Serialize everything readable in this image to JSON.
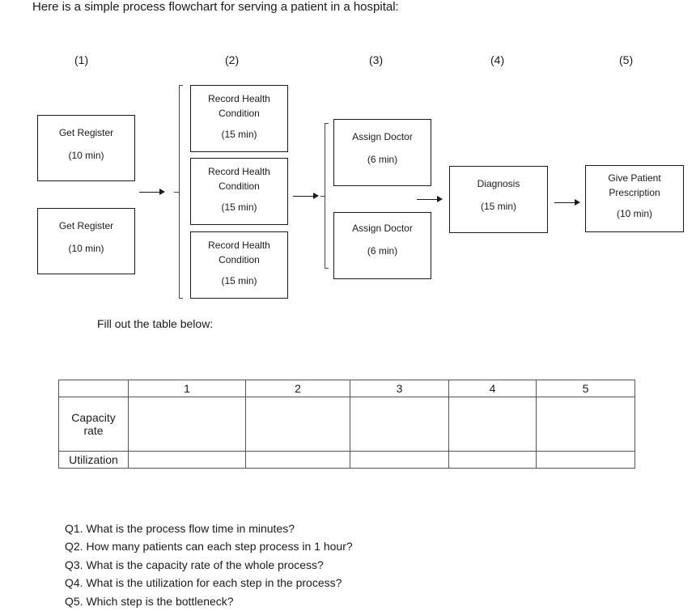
{
  "intro": "Here is a simple process flowchart for serving a patient in a hospital:",
  "step_numbers": [
    "(1)",
    "(2)",
    "(3)",
    "(4)",
    "(5)"
  ],
  "steps": [
    {
      "name": "Get Register",
      "time": "(10 min)",
      "count": 2
    },
    {
      "name": "Record Health Condition",
      "time": "(15 min)",
      "count": 3
    },
    {
      "name": "Assign Doctor",
      "time": "(6 min)",
      "count": 2
    },
    {
      "name": "Diagnosis",
      "time": "(15 min)",
      "count": 1
    },
    {
      "name": "Give Patient Prescription",
      "time": "(10 min)",
      "count": 1
    }
  ],
  "labels": {
    "get_register": "Get Register",
    "time_10": "(10 min)",
    "record_1": "Record Health",
    "record_2": "Condition",
    "time_15": "(15 min)",
    "assign": "Assign Doctor",
    "time_6": "(6 min)",
    "diagnosis": "Diagnosis",
    "give_1": "Give Patient",
    "give_2": "Prescription"
  },
  "fill_instruction": "Fill out the table below:",
  "table": {
    "columns": [
      "",
      "1",
      "2",
      "3",
      "4",
      "5"
    ],
    "rows": [
      {
        "label_line1": "Capacity",
        "label_line2": "rate",
        "cells": [
          "",
          "",
          "",
          "",
          ""
        ]
      },
      {
        "label_line1": "Utilization",
        "label_line2": "",
        "cells": [
          "",
          "",
          "",
          "",
          ""
        ]
      }
    ]
  },
  "questions": [
    "Q1. What is the process flow time in minutes?",
    "Q2. How many patients can each step process in 1 hour?",
    "Q3. What is the capacity rate of the whole process?",
    "Q4. What is the utilization for each step in the process?",
    "Q5. Which step is the bottleneck?"
  ]
}
